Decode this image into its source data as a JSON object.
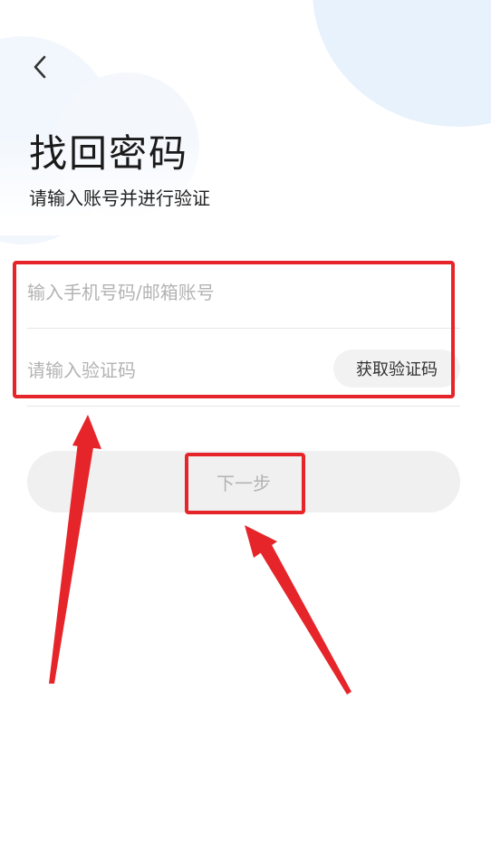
{
  "header": {
    "back_icon": "chevron-left-icon",
    "title": "找回密码",
    "subtitle": "请输入账号并进行验证"
  },
  "form": {
    "phone_placeholder": "输入手机号码/邮箱账号",
    "code_placeholder": "请输入验证码",
    "get_code_label": "获取验证码",
    "next_label": "下一步"
  },
  "colors": {
    "annotation": "#e5252a",
    "background_cloud": "#e8f2fc",
    "button_bg": "#f0f0f0",
    "placeholder": "#b3b3b3"
  }
}
